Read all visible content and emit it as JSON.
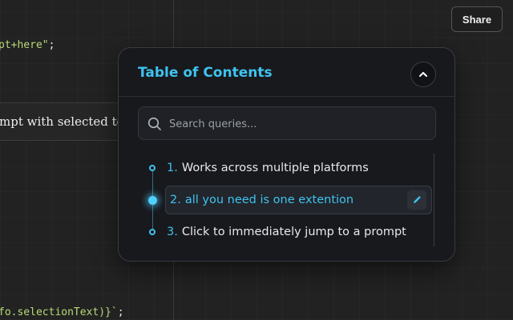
{
  "editor": {
    "code_line_1": "pt+here\"",
    "code_line_1_end": ";",
    "selected_text_fragment": "mpt with selected tex",
    "code_line_2": "fo.selectionText)}`",
    "code_line_2_end": ";"
  },
  "header": {
    "share_label": "Share"
  },
  "toc": {
    "title": "Table of Contents",
    "search_placeholder": "Search queries...",
    "items": [
      {
        "number": "1.",
        "text": "Works across multiple platforms",
        "active": false
      },
      {
        "number": "2.",
        "text": "all you need is one extention",
        "active": true
      },
      {
        "number": "3.",
        "text": "Click to immediately jump to a prompt",
        "active": false
      }
    ],
    "icons": {
      "collapse": "chevron-up-icon",
      "search": "search-icon",
      "edit": "pencil-icon"
    }
  },
  "colors": {
    "accent": "#3ec3ef",
    "panel_bg": "#18191d",
    "code_string": "#b9d977"
  }
}
